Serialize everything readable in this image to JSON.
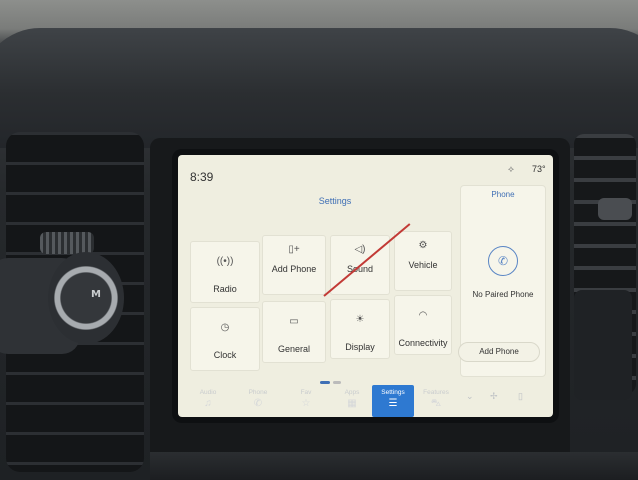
{
  "status": {
    "time": "8:39",
    "temperature": "73°",
    "signal_icon": "signal-icon"
  },
  "settings": {
    "title": "Settings",
    "tiles": [
      {
        "label": "Radio",
        "icon": "radio-icon"
      },
      {
        "label": "Add Phone",
        "icon": "phone-add-icon"
      },
      {
        "label": "Sound",
        "icon": "speaker-icon"
      },
      {
        "label": "Vehicle",
        "icon": "vehicle-icon"
      },
      {
        "label": "Clock",
        "icon": "clock-icon"
      },
      {
        "label": "General",
        "icon": "general-icon"
      },
      {
        "label": "Display",
        "icon": "display-icon"
      },
      {
        "label": "Connectivity",
        "icon": "wifi-icon"
      }
    ]
  },
  "phone": {
    "title": "Phone",
    "status": "No Paired Phone",
    "button": "Add Phone",
    "icon": "phone-icon"
  },
  "dock": {
    "items": [
      {
        "label": "Audio",
        "icon": "music-note-icon"
      },
      {
        "label": "Phone",
        "icon": "phone-icon"
      },
      {
        "label": "Fav",
        "icon": "star-icon"
      },
      {
        "label": "Apps",
        "icon": "apps-grid-icon"
      },
      {
        "label": "Settings",
        "icon": "settings-sliders-icon",
        "active": true
      },
      {
        "label": "Features",
        "icon": "car-icon"
      }
    ]
  },
  "vehicle_badge": "M",
  "colors": {
    "accent": "#3f6fb5",
    "active_tab": "#2e79d1",
    "screen_bg": "#efeee0"
  }
}
